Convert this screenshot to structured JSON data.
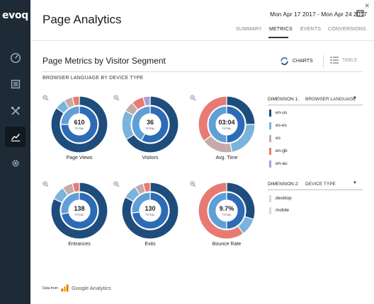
{
  "app": {
    "logo_text": "evoq"
  },
  "sidebar": {
    "items": [
      {
        "icon": "dashboard-gauge-icon"
      },
      {
        "icon": "content-list-icon"
      },
      {
        "icon": "tools-icon"
      },
      {
        "icon": "analytics-chart-icon",
        "active": true
      },
      {
        "icon": "settings-gear-icon"
      }
    ]
  },
  "header": {
    "title": "Page Analytics",
    "date_range": "Mon Apr 17 2017 - Mon Apr 24 2017",
    "tabs": [
      {
        "label": "SUMMARY",
        "active": false
      },
      {
        "label": "METRICS",
        "active": true
      },
      {
        "label": "EVENTS",
        "active": false
      },
      {
        "label": "CONVERSIONS",
        "active": false
      }
    ]
  },
  "main": {
    "section_title": "Page Metrics by Visitor Segment",
    "view_toggle": {
      "charts_label": "CHARTS",
      "table_label": "TABLE",
      "active": "charts"
    },
    "subtitle": "BROWSER LANGUAGE BY DEVICE TYPE"
  },
  "dimension1": {
    "label": "DIMENSION 1:",
    "value": "BROWSER LANGUAGE",
    "legend": [
      {
        "label": "en-us",
        "color": "#1e4d7b"
      },
      {
        "label": "es-es",
        "color": "#7ab3db"
      },
      {
        "label": "es",
        "color": "#c4aba7"
      },
      {
        "label": "en-gb",
        "color": "#e77b73"
      },
      {
        "label": "en-au",
        "color": "#ab9fd6"
      }
    ]
  },
  "dimension2": {
    "label": "DIMENSION 2:",
    "value": "DEVICE TYPE",
    "legend": [
      {
        "label": "desktop",
        "color": "#d7d9db"
      },
      {
        "label": "mobile",
        "color": "#d7d9db"
      }
    ]
  },
  "chart_data": [
    {
      "type": "donut",
      "title": "Page Views",
      "total": "610",
      "total_label": "TOTAL",
      "outer": [
        {
          "k": "en-us",
          "v": 0.85
        },
        {
          "k": "es-es",
          "v": 0.06
        },
        {
          "k": "es",
          "v": 0.05
        },
        {
          "k": "en-gb",
          "v": 0.04
        }
      ],
      "inner": [
        {
          "k": "en-us",
          "v": 0.75
        },
        {
          "k": "es-es",
          "v": 0.25
        }
      ]
    },
    {
      "type": "donut",
      "title": "Visitors",
      "total": "36",
      "total_label": "TOTAL",
      "outer": [
        {
          "k": "en-us",
          "v": 0.66
        },
        {
          "k": "es-es",
          "v": 0.17
        },
        {
          "k": "es",
          "v": 0.06
        },
        {
          "k": "en-gb",
          "v": 0.07
        },
        {
          "k": "en-au",
          "v": 0.04
        }
      ],
      "inner": [
        {
          "k": "en-us",
          "v": 0.58
        },
        {
          "k": "es-es",
          "v": 0.42
        }
      ]
    },
    {
      "type": "donut",
      "title": "Avg. Time",
      "total": "03:04",
      "total_label": "TOTAL",
      "outer": [
        {
          "k": "en-us",
          "v": 0.25
        },
        {
          "k": "es-es",
          "v": 0.22
        },
        {
          "k": "es",
          "v": 0.18
        },
        {
          "k": "en-gb",
          "v": 0.35
        }
      ],
      "inner": [
        {
          "k": "en-us",
          "v": 0.5
        },
        {
          "k": "es-es",
          "v": 0.5
        }
      ]
    },
    {
      "type": "donut",
      "title": "Entrances",
      "total": "138",
      "total_label": "TOTAL",
      "outer": [
        {
          "k": "en-us",
          "v": 0.82
        },
        {
          "k": "es-es",
          "v": 0.08
        },
        {
          "k": "es",
          "v": 0.06
        },
        {
          "k": "en-gb",
          "v": 0.04
        }
      ],
      "inner": [
        {
          "k": "en-us",
          "v": 0.72
        },
        {
          "k": "es-es",
          "v": 0.28
        }
      ]
    },
    {
      "type": "donut",
      "title": "Exits",
      "total": "130",
      "total_label": "TOTAL",
      "outer": [
        {
          "k": "en-us",
          "v": 0.83
        },
        {
          "k": "es-es",
          "v": 0.08
        },
        {
          "k": "es",
          "v": 0.05
        },
        {
          "k": "en-gb",
          "v": 0.04
        }
      ],
      "inner": [
        {
          "k": "en-us",
          "v": 0.73
        },
        {
          "k": "es-es",
          "v": 0.27
        }
      ]
    },
    {
      "type": "donut",
      "title": "Bounce Rate",
      "total": "9.7%",
      "total_label": "TOTAL",
      "outer": [
        {
          "k": "en-us",
          "v": 0.3
        },
        {
          "k": "es-es",
          "v": 0.1
        },
        {
          "k": "en-gb",
          "v": 0.6
        }
      ],
      "inner": [
        {
          "k": "en-us",
          "v": 0.5
        },
        {
          "k": "es-es",
          "v": 0.5
        }
      ]
    }
  ],
  "footer": {
    "prefix": "Data from",
    "provider": "Google Analytics"
  }
}
